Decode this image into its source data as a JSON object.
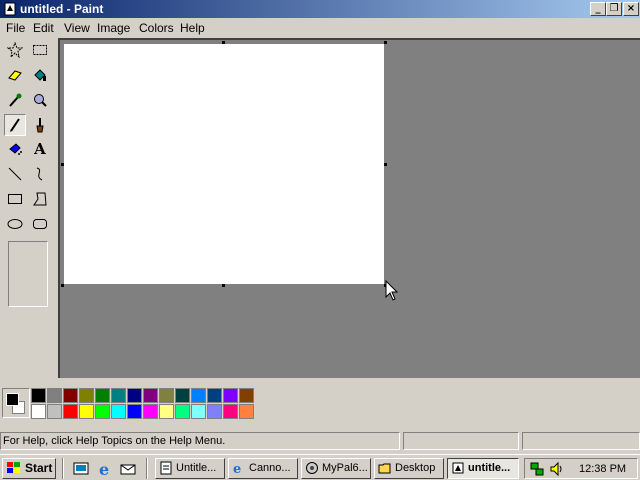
{
  "window": {
    "title": "untitled - Paint",
    "minimize_glyph": "_",
    "maximize_glyph": "❐",
    "close_glyph": "×"
  },
  "menu": [
    "File",
    "Edit",
    "View",
    "Image",
    "Colors",
    "Help"
  ],
  "tools": [
    {
      "name": "free-form-select",
      "icon": "star-select-icon"
    },
    {
      "name": "select",
      "icon": "rect-select-icon"
    },
    {
      "name": "eraser",
      "icon": "eraser-icon"
    },
    {
      "name": "fill",
      "icon": "paint-bucket-icon"
    },
    {
      "name": "pick-color",
      "icon": "eyedropper-icon"
    },
    {
      "name": "magnifier",
      "icon": "magnifier-icon"
    },
    {
      "name": "pencil",
      "icon": "pencil-icon",
      "selected": true
    },
    {
      "name": "brush",
      "icon": "brush-icon"
    },
    {
      "name": "airbrush",
      "icon": "airbrush-icon"
    },
    {
      "name": "text",
      "icon": "text-icon",
      "label": "A"
    },
    {
      "name": "line",
      "icon": "line-icon"
    },
    {
      "name": "curve",
      "icon": "curve-icon"
    },
    {
      "name": "rectangle",
      "icon": "rectangle-icon"
    },
    {
      "name": "polygon",
      "icon": "polygon-icon"
    },
    {
      "name": "ellipse",
      "icon": "ellipse-icon"
    },
    {
      "name": "rounded-rectangle",
      "icon": "rounded-rect-icon"
    }
  ],
  "colors": {
    "foreground": "#000000",
    "background": "#ffffff",
    "palette_top": [
      "#000000",
      "#808080",
      "#800000",
      "#808000",
      "#008000",
      "#008080",
      "#000080",
      "#800080",
      "#808040",
      "#004040",
      "#0080ff",
      "#004080",
      "#8000ff",
      "#804000"
    ],
    "palette_bottom": [
      "#ffffff",
      "#c0c0c0",
      "#ff0000",
      "#ffff00",
      "#00ff00",
      "#00ffff",
      "#0000ff",
      "#ff00ff",
      "#ffff80",
      "#00ff80",
      "#80ffff",
      "#8080ff",
      "#ff0080",
      "#ff8040"
    ]
  },
  "status": {
    "help_text": "For Help, click Help Topics on the Help Menu."
  },
  "taskbar": {
    "start_label": "Start",
    "buttons": [
      {
        "label": "Untitle...",
        "icon": "notepad-icon",
        "active": false
      },
      {
        "label": "Canno...",
        "icon": "ie-icon",
        "active": false
      },
      {
        "label": "MyPal6...",
        "icon": "mypal-icon",
        "active": false
      },
      {
        "label": "Desktop",
        "icon": "folder-icon",
        "active": false
      },
      {
        "label": "untitle...",
        "icon": "paint-icon",
        "active": true
      }
    ],
    "clock": "12:38 PM"
  }
}
